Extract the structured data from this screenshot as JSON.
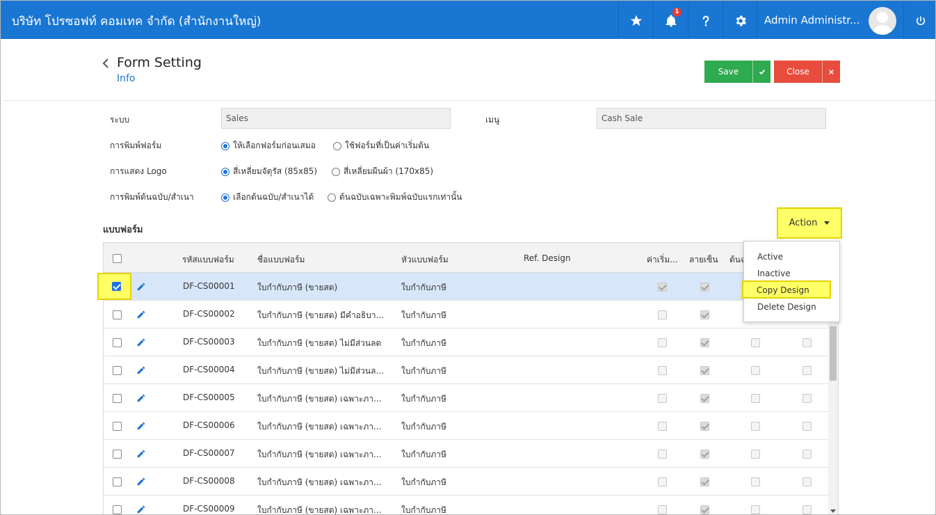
{
  "topbar": {
    "company": "บริษัท โปรซอฟท์ คอมเทค จำกัด (สำนักงานใหญ่)",
    "notification_count": "1",
    "user_name": "Admin Administr...",
    "icons": [
      "star-icon",
      "bell-icon",
      "help-icon",
      "gear-icon",
      "power-icon"
    ]
  },
  "header": {
    "title": "Form Setting",
    "subtitle": "Info",
    "save_label": "Save",
    "close_label": "Close"
  },
  "form": {
    "system_label": "ระบบ",
    "system_value": "Sales",
    "menu_label": "เมนู",
    "menu_value": "Cash Sale",
    "print_label": "การพิมพ์ฟอร์ม",
    "print_opt1": "ให้เลือกฟอร์มก่อนเสมอ",
    "print_opt2": "ใช้ฟอร์มที่เป็นค่าเริ่มต้น",
    "logo_label": "การแสดง Logo",
    "logo_opt1": "สี่เหลี่ยมจัตุรัส (85x85)",
    "logo_opt2": "สี่เหลี่ยมผืนผ้า (170x85)",
    "copy_label": "การพิมพ์ต้นฉบับ/สำเนา",
    "copy_opt1": "เลือกต้นฉบับ/สำเนาได้",
    "copy_opt2": "ต้นฉบับเฉพาะพิมพ์ฉบับแรกเท่านั้น"
  },
  "section": {
    "title": "แบบฟอร์ม",
    "action_label": "Action"
  },
  "action_menu": [
    "Active",
    "Inactive",
    "Copy Design",
    "Delete Design"
  ],
  "table": {
    "headers": {
      "code": "รหัสแบบฟอร์ม",
      "name": "ชื่อแบบฟอร์ม",
      "header": "หัวแบบฟอร์ม",
      "ref": "Ref. Design",
      "default": "ค่าเริ่ม...",
      "signature": "ลายเซ็น",
      "original": "ต้นฉ"
    },
    "rows": [
      {
        "code": "DF-CS00001",
        "name": "ใบกำกับภาษี (ขายสด)",
        "header": "ใบกำกับภาษี",
        "selected": true,
        "default": true,
        "signature": true
      },
      {
        "code": "DF-CS00002",
        "name": "ใบกำกับภาษี (ขายสด) มีคำอธิบา...",
        "header": "ใบกำกับภาษี",
        "selected": false,
        "default": false,
        "signature": true
      },
      {
        "code": "DF-CS00003",
        "name": "ใบกำกับภาษี (ขายสด) ไม่มีส่วนลด",
        "header": "ใบกำกับภาษี",
        "selected": false,
        "default": false,
        "signature": true
      },
      {
        "code": "DF-CS00004",
        "name": "ใบกำกับภาษี (ขายสด) ไม่มีส่วนล...",
        "header": "ใบกำกับภาษี",
        "selected": false,
        "default": false,
        "signature": true
      },
      {
        "code": "DF-CS00005",
        "name": "ใบกำกับภาษี (ขายสด) เฉพาะภา...",
        "header": "ใบกำกับภาษี",
        "selected": false,
        "default": false,
        "signature": true
      },
      {
        "code": "DF-CS00006",
        "name": "ใบกำกับภาษี (ขายสด) เฉพาะภา...",
        "header": "ใบกำกับภาษี",
        "selected": false,
        "default": false,
        "signature": true
      },
      {
        "code": "DF-CS00007",
        "name": "ใบกำกับภาษี (ขายสด) เฉพาะภา...",
        "header": "ใบกำกับภาษี",
        "selected": false,
        "default": false,
        "signature": true
      },
      {
        "code": "DF-CS00008",
        "name": "ใบกำกับภาษี (ขายสด) เฉพาะภา...",
        "header": "ใบกำกับภาษี",
        "selected": false,
        "default": false,
        "signature": true
      },
      {
        "code": "DF-CS00009",
        "name": "ใบกำกับภาษี (ขายสด) เฉพาะภา...",
        "header": "ใบกำกับภาษี",
        "selected": false,
        "default": false,
        "signature": true
      }
    ]
  },
  "colors": {
    "topbar": "#1976d2",
    "save": "#2eaa4f",
    "close": "#e74c3c",
    "highlight": "#ffff66",
    "selected_row": "#d7e6f8"
  }
}
